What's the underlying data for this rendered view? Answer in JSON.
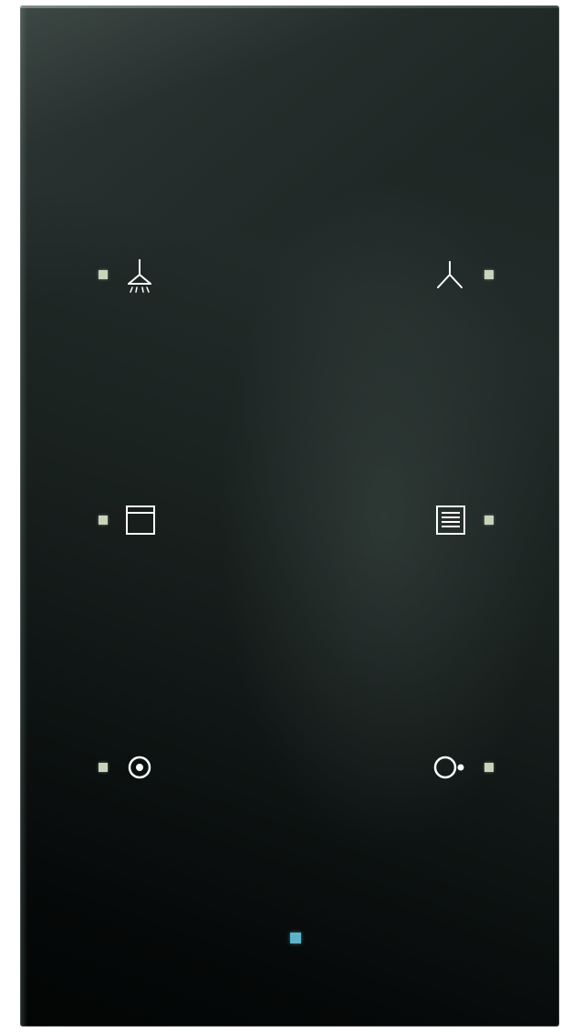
{
  "panel": {
    "colors": {
      "glass": "#1a2220",
      "indicator_led": "#c7d4b9",
      "status_led": "#5fb3c9",
      "symbol": "#ffffff"
    }
  },
  "buttons": [
    {
      "id": "top-left",
      "icon": "ceiling-light-dimming-icon",
      "led": "indicator-led"
    },
    {
      "id": "top-right",
      "icon": "ceiling-light-icon",
      "led": "indicator-led"
    },
    {
      "id": "middle-left",
      "icon": "blind-up-icon",
      "led": "indicator-led"
    },
    {
      "id": "middle-right",
      "icon": "blind-down-icon",
      "led": "indicator-led"
    },
    {
      "id": "bottom-left",
      "icon": "scene-on-icon",
      "led": "indicator-led"
    },
    {
      "id": "bottom-right",
      "icon": "scene-off-icon",
      "led": "indicator-led"
    }
  ],
  "status_indicator": {
    "icon": "status-led"
  }
}
